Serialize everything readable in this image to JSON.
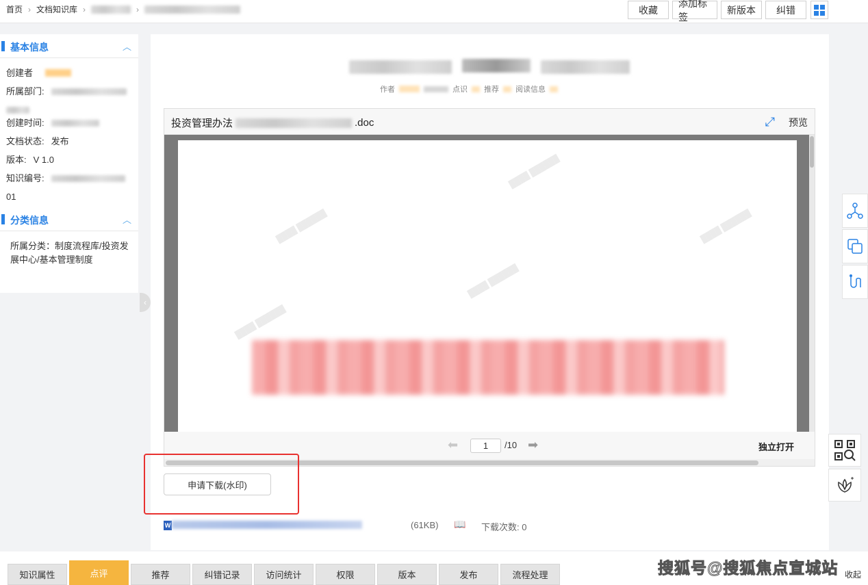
{
  "breadcrumb": {
    "home": "首页",
    "library": "文档知识库"
  },
  "top_actions": [
    "收藏",
    "添加标签",
    "新版本",
    "纠错"
  ],
  "basic_info": {
    "title": "基本信息",
    "creator_label": "创建者",
    "dept_label": "所属部门:",
    "created_label": "创建时间:",
    "status_label": "文档状态:",
    "status_value": "发布",
    "version_label": "版本:",
    "version_value": "V 1.0",
    "code_label": "知识编号:",
    "code_suffix": "01"
  },
  "category_info": {
    "title": "分类信息",
    "text": "所属分类：制度流程库/投资发展中心/基本管理制度"
  },
  "meta": {
    "author": "作者",
    "clicks": "点识",
    "recommend": "推荐",
    "read_info": "阅读信息"
  },
  "viewer": {
    "file_prefix": "投资管理办法",
    "file_ext": ".doc",
    "preview": "预览",
    "page_current": "1",
    "page_total": "/10",
    "open_standalone": "独立打开"
  },
  "download_button": "申请下载(水印)",
  "file_row": {
    "icon": "W",
    "size": "(61KB)",
    "download_count": "下载次数: 0"
  },
  "bottom_tabs": [
    {
      "label": "知识属性",
      "active": false
    },
    {
      "label": "点评",
      "active": true
    },
    {
      "label": "推荐",
      "active": false
    },
    {
      "label": "纠错记录",
      "active": false
    },
    {
      "label": "访问统计",
      "active": false
    },
    {
      "label": "权限",
      "active": false
    },
    {
      "label": "版本",
      "active": false
    },
    {
      "label": "发布",
      "active": false
    },
    {
      "label": "流程处理",
      "active": false
    }
  ],
  "brand_watermark": "搜狐号@搜狐焦点宣城站",
  "collapse_label": "收起",
  "colors": {
    "accent": "#2a82e4",
    "active_tab": "#f5b53f",
    "highlight": "#e8312f"
  }
}
